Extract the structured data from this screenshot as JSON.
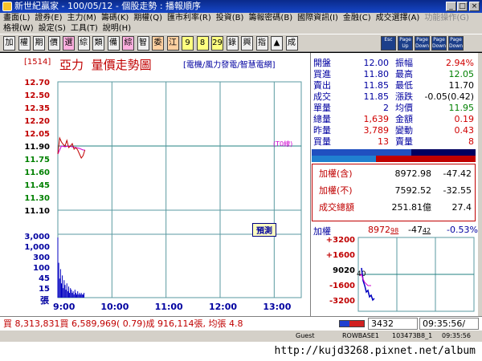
{
  "window": {
    "title": "新世紀贏家 - 100/05/12 - 個股走勢 : 播報順序"
  },
  "menu": {
    "row1": [
      "畫面(L)",
      "證券(E)",
      "主力(M)",
      "籌碼(K)",
      "期權(Q)",
      "匯市利率(R)",
      "投資(B)",
      "籌報密碼(B)",
      "國際資訊(I)",
      "金融(C)",
      "成交選擇(A)",
      "功能操作(G)"
    ],
    "row1_disabled": [
      11
    ],
    "row2": [
      "格視(W)",
      "設定(S)",
      "工具(T)",
      "說明(H)"
    ]
  },
  "toolbar": {
    "buttons": [
      "加",
      "權",
      "期",
      "價",
      "選",
      "綜",
      "類",
      "備",
      "綜",
      "智",
      "委",
      "江",
      "9",
      "8",
      "29",
      "錄",
      "興",
      "指",
      "▲",
      "成"
    ],
    "extra_buttons": [
      "Esc",
      "Page Up",
      "Page Down",
      "Page Down",
      "Page Down"
    ]
  },
  "chart": {
    "code": "[1514]",
    "name": "亞力",
    "title": "量價走勢圖",
    "subtitle": "[電機/風力發電/智慧電網]",
    "ref_label": "(T0線)",
    "badge": "預測",
    "vol_unit": "張"
  },
  "chart_data": {
    "type": "line",
    "price_ticks": [
      "12.70",
      "12.50",
      "12.35",
      "12.20",
      "12.05",
      "11.90",
      "11.75",
      "11.60",
      "11.45",
      "11.30",
      "11.10"
    ],
    "price_ylim": [
      11.1,
      12.7
    ],
    "reference_price": 11.9,
    "volume_ticks": [
      "3,000",
      "1,000",
      "300",
      "100",
      "45",
      "15"
    ],
    "time_ticks": [
      "9:00",
      "10:00",
      "11:00",
      "12:00",
      "13:00"
    ],
    "price_series": [
      {
        "t": 0,
        "v": 11.8
      },
      {
        "t": 2,
        "v": 12.0
      },
      {
        "t": 4,
        "v": 11.95
      },
      {
        "t": 6,
        "v": 11.92
      },
      {
        "t": 8,
        "v": 11.9
      },
      {
        "t": 10,
        "v": 11.97
      },
      {
        "t": 12,
        "v": 11.88
      },
      {
        "t": 14,
        "v": 11.9
      },
      {
        "t": 16,
        "v": 11.93
      },
      {
        "t": 18,
        "v": 11.86
      },
      {
        "t": 20,
        "v": 11.88
      },
      {
        "t": 22,
        "v": 11.85
      },
      {
        "t": 24,
        "v": 11.8
      },
      {
        "t": 26,
        "v": 11.75
      },
      {
        "t": 28,
        "v": 11.78
      },
      {
        "t": 30,
        "v": 11.85
      }
    ],
    "avg_series": [
      {
        "t": 0,
        "v": 11.8
      },
      {
        "t": 4,
        "v": 11.9
      },
      {
        "t": 8,
        "v": 11.89
      },
      {
        "t": 12,
        "v": 11.9
      },
      {
        "t": 16,
        "v": 11.89
      },
      {
        "t": 20,
        "v": 11.88
      },
      {
        "t": 24,
        "v": 11.87
      },
      {
        "t": 28,
        "v": 11.85
      },
      {
        "t": 30,
        "v": 11.85
      }
    ],
    "volume_series": [
      38,
      22,
      12,
      18,
      9,
      14,
      6,
      11,
      8,
      5,
      9,
      4,
      7,
      3,
      6,
      5,
      3,
      4,
      2,
      5,
      3,
      2,
      4,
      2,
      3,
      2,
      3,
      2,
      2,
      3
    ],
    "volume_max": 40
  },
  "quote": {
    "rows": [
      {
        "l1": "開盤",
        "v1": "12.00",
        "l2": "振幅",
        "v2": "2.94%",
        "c1": "#0000a0",
        "c2": "#d00000"
      },
      {
        "l1": "買進",
        "v1": "11.80",
        "l2": "最高",
        "v2": "12.05",
        "c1": "#0000a0",
        "c2": "#008000"
      },
      {
        "l1": "賣出",
        "v1": "11.85",
        "l2": "最低",
        "v2": "11.70",
        "c1": "#0000a0",
        "c2": "#000000"
      },
      {
        "l1": "成交",
        "v1": "11.85",
        "l2": "漲跌",
        "v2": "-0.05(0.42)",
        "c1": "#0000a0",
        "c2": "#000000"
      },
      {
        "l1": "單量",
        "v1": "2",
        "l2": "均價",
        "v2": "11.95",
        "c1": "#0000a0",
        "c2": "#008000"
      },
      {
        "l1": "總量",
        "v1": "1,639",
        "l2": "金額",
        "v2": "0.19",
        "c1": "#d00000",
        "c2": "#d00000"
      },
      {
        "l1": "昨量",
        "v1": "3,789",
        "l2": "變動",
        "v2": "0.43",
        "c1": "#d00000",
        "c2": "#d00000"
      },
      {
        "l1": "買量",
        "v1": "13",
        "l2": "賣量",
        "v2": "8",
        "c1": "#d00000",
        "c2": "#d00000"
      }
    ],
    "buy_ratio": 0.61
  },
  "index": {
    "rows": [
      {
        "label": "加權(含)",
        "value": "8972.98",
        "change": "-47.42"
      },
      {
        "label": "加權(不)",
        "value": "7592.52",
        "change": "-32.55"
      },
      {
        "label": "成交總額",
        "value": "251.81億",
        "change": "27.4"
      }
    ],
    "mini_label": "加權",
    "mini_value": "8972",
    "mini_value_frac": "98",
    "mini_change": "-47",
    "mini_change_frac": "42",
    "mini_pct": "-0.53%",
    "mini_ticks": [
      "+3200",
      "+1600",
      "9020",
      "-1600",
      "-3200"
    ],
    "mini_right": "40"
  },
  "status": {
    "text": "買 8,313,831買 6,589,969( 0.79)成 916,114張, 均張 4.8",
    "code": "3432",
    "time": "09:35:56/"
  },
  "bottom": {
    "user": "Guest",
    "session": "ROWBASE1",
    "build": "103473B8_1",
    "clock": "09:35:56"
  },
  "watermark": "http://kujd3268.pixnet.net/album",
  "colors": {
    "grid": "#5a9aa0",
    "price_line": "#c00000",
    "avg_line": "#d000d0",
    "volume": "#0000c0",
    "ref_line": "#208080"
  }
}
